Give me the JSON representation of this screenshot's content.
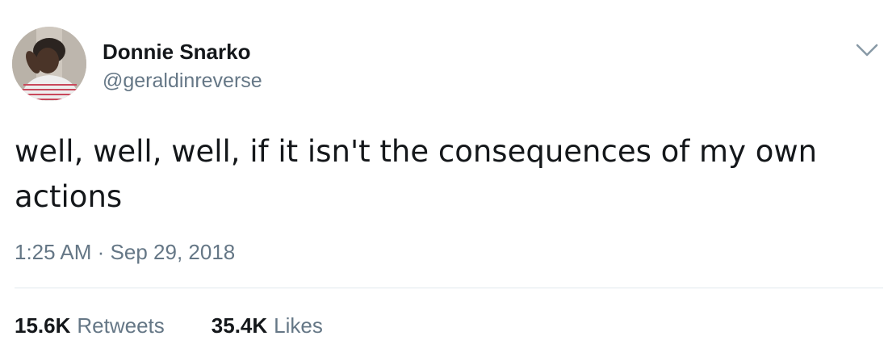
{
  "user": {
    "name": "Donnie Snarko",
    "handle": "@geraldinreverse",
    "avatar_icon": "profile-photo"
  },
  "tweet": {
    "text": "well, well, well, if it isn't the consequences of my own actions",
    "time": "1:25 AM",
    "separator": "·",
    "date": "Sep 29, 2018"
  },
  "stats": {
    "retweets_count": "15.6K",
    "retweets_label": "Retweets",
    "likes_count": "35.4K",
    "likes_label": "Likes"
  },
  "menu": {
    "icon": "chevron-down-icon"
  },
  "colors": {
    "text_primary": "#14171a",
    "text_secondary": "#657786",
    "divider": "#e1e8ed"
  }
}
